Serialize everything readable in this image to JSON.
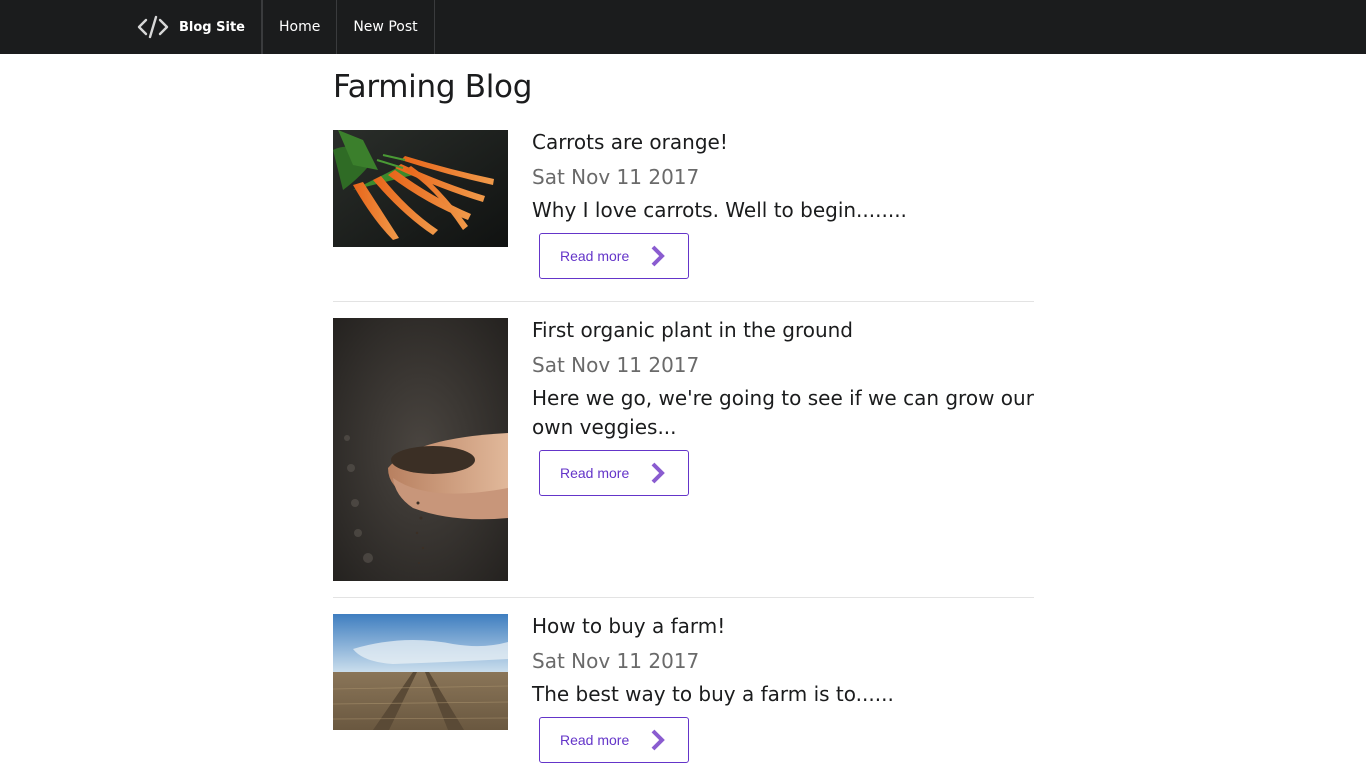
{
  "nav": {
    "brand_icon": "code-icon",
    "brand_label": "Blog Site",
    "items": [
      {
        "label": "Home"
      },
      {
        "label": "New Post"
      }
    ]
  },
  "page": {
    "title": "Farming Blog"
  },
  "posts": [
    {
      "title": "Carrots are orange!",
      "date": "Sat Nov 11 2017",
      "excerpt": "Why I love carrots. Well to begin........",
      "read_more": "Read more",
      "image": "carrots-photo"
    },
    {
      "title": "First organic plant in the ground",
      "date": "Sat Nov 11 2017",
      "excerpt": "Here we go, we're going to see if we can grow our own veggies...",
      "read_more": "Read more",
      "image": "soil-hands-photo"
    },
    {
      "title": "How to buy a farm!",
      "date": "Sat Nov 11 2017",
      "excerpt": "The best way to buy a farm is to......",
      "read_more": "Read more",
      "image": "field-photo"
    }
  ],
  "colors": {
    "topbar": "#1b1c1d",
    "accent": "#6435c9",
    "chevron": "#8a5cd0",
    "date": "#6a6a6a"
  }
}
